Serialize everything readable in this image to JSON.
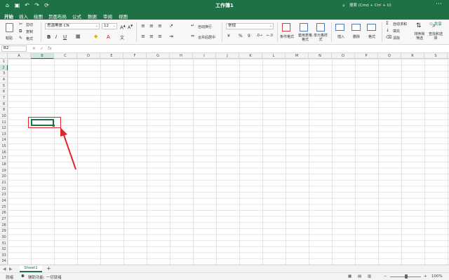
{
  "title_bar": {
    "title": "工作簿1",
    "search_placeholder": "搜索 (Cmd + Ctrl + U)",
    "icons": [
      "home-icon",
      "save-icon",
      "undo-icon",
      "redo-icon",
      "refresh-icon"
    ],
    "accent_color": "#1e7145"
  },
  "menu": {
    "tabs": [
      "开始",
      "插入",
      "绘图",
      "页面布局",
      "公式",
      "数据",
      "审阅",
      "视图"
    ],
    "active": "开始"
  },
  "ribbon": {
    "clipboard": {
      "paste": "粘贴",
      "cut": "剪切",
      "copy": "复制",
      "format": "格式"
    },
    "font": {
      "name": "思源黑体 CN",
      "size": "12",
      "bold": "B",
      "italic": "I",
      "underline": "U"
    },
    "alignment": {
      "wrap_text": "自动换行",
      "merge_center": "合并后居中"
    },
    "number": {
      "format": "常规",
      "percent": "%",
      "comma": "9"
    },
    "styles": {
      "conditional": "条件格式",
      "table_format": "套用表格格式",
      "cell_styles": "单元格样式"
    },
    "cells": {
      "insert": "插入",
      "delete": "删除",
      "format": "格式"
    },
    "editing": {
      "autosum": "自动求和",
      "fill": "填充",
      "clear": "清除",
      "sort_filter": "排序和筛选",
      "find_select": "查找和选择"
    },
    "share": "共享"
  },
  "formula_bar": {
    "name_box": "B2",
    "cancel": "✕",
    "confirm": "✓",
    "fx": "fx",
    "formula": ""
  },
  "grid": {
    "columns": [
      "A",
      "B",
      "C",
      "D",
      "E",
      "F",
      "G",
      "H",
      "I",
      "J",
      "K",
      "L",
      "M",
      "N",
      "O",
      "P",
      "Q",
      "R",
      "S"
    ],
    "rows": [
      "1",
      "2",
      "3",
      "4",
      "5",
      "6",
      "7",
      "8",
      "9",
      "10",
      "11",
      "12",
      "13",
      "14",
      "15",
      "16",
      "17",
      "18",
      "19",
      "20",
      "21",
      "22",
      "23",
      "24",
      "25",
      "26",
      "27",
      "28",
      "29",
      "30",
      "31",
      "32",
      "33",
      "34"
    ],
    "selected_column": "B",
    "selected_row": "2",
    "annotation_color": "#e0262b"
  },
  "sheets": {
    "tabs": [
      "Sheet1"
    ],
    "add_label": "+"
  },
  "status_bar": {
    "ready": "就绪",
    "accessibility": "辅助功能: 一切就绪",
    "zoom": "100%",
    "zoom_minus": "−",
    "zoom_plus": "+"
  }
}
